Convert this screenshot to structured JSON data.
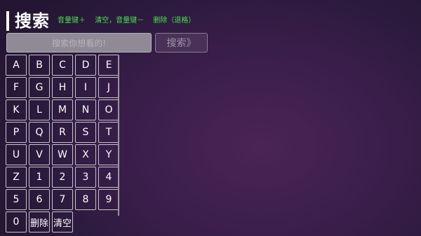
{
  "header": {
    "title": "搜索",
    "hints": [
      "音量键＋",
      "清空，音量键－",
      "删除（退格）"
    ]
  },
  "search": {
    "placeholder": "搜索你想看的!",
    "button_label": "搜索》"
  },
  "keyboard": {
    "keys": [
      "A",
      "B",
      "C",
      "D",
      "E",
      "F",
      "G",
      "H",
      "I",
      "J",
      "K",
      "L",
      "M",
      "N",
      "O",
      "P",
      "Q",
      "R",
      "S",
      "T",
      "U",
      "V",
      "W",
      "X",
      "Y",
      "Z",
      "1",
      "2",
      "3",
      "4",
      "5",
      "6",
      "7",
      "8",
      "9",
      "0",
      "删除",
      "清空"
    ]
  }
}
